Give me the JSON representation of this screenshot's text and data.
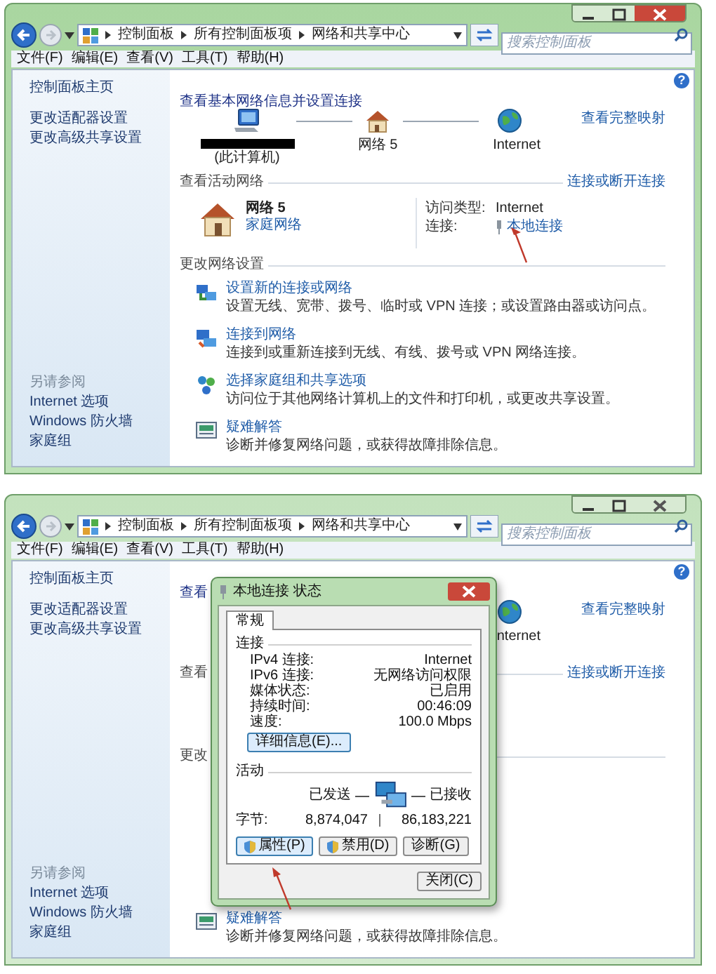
{
  "windows": [
    {
      "active": true,
      "breadcrumb": [
        "控制面板",
        "所有控制面板项",
        "网络和共享中心"
      ],
      "search": {
        "placeholder": "搜索控制面板"
      },
      "menu": [
        "文件(F)",
        "编辑(E)",
        "查看(V)",
        "工具(T)",
        "帮助(H)"
      ],
      "sidebar": {
        "links": [
          "控制面板主页",
          "更改适配器设置",
          "更改高级共享设置"
        ],
        "see_also_title": "另请参阅",
        "see_also": [
          "Internet 选项",
          "Windows 防火墙",
          "家庭组"
        ]
      },
      "main": {
        "help_icon": "?",
        "title": "查看基本网络信息并设置连接",
        "map": [
          {
            "kind": "computer",
            "label": "(此计算机)",
            "redacted": true
          },
          {
            "kind": "house",
            "label": "网络 5",
            "redacted": false
          },
          {
            "kind": "globe",
            "label": "Internet",
            "redacted": false
          }
        ],
        "map_link": "查看完整映射",
        "active_section": {
          "title": "查看活动网络",
          "link": "连接或断开连接"
        },
        "network": {
          "name": "网络 5",
          "type": "家庭网络",
          "access_label": "访问类型:",
          "access_value": "Internet",
          "connection_label": "连接:",
          "connection_value": "本地连接"
        },
        "change_section": "更改网络设置",
        "tasks": [
          {
            "kind": "setup",
            "link": "设置新的连接或网络",
            "description": "设置无线、宽带、拨号、临时或 VPN 连接；或设置路由器或访问点。"
          },
          {
            "kind": "connect",
            "link": "连接到网络",
            "description": "连接到或重新连接到无线、有线、拨号或 VPN 网络连接。"
          },
          {
            "kind": "homegroup",
            "link": "选择家庭组和共享选项",
            "description": "访问位于其他网络计算机上的文件和打印机，或更改共享设置。"
          },
          {
            "kind": "troubleshoot",
            "link": "疑难解答",
            "description": "诊断并修复网络问题，或获得故障排除信息。"
          }
        ]
      },
      "annotation_arrow": true
    },
    {
      "active": false,
      "breadcrumb": [
        "控制面板",
        "所有控制面板项",
        "网络和共享中心"
      ],
      "search": {
        "placeholder": "搜索控制面板"
      },
      "menu": [
        "文件(F)",
        "编辑(E)",
        "查看(V)",
        "工具(T)",
        "帮助(H)"
      ],
      "sidebar": {
        "links": [
          "控制面板主页",
          "更改适配器设置",
          "更改高级共享设置"
        ],
        "see_also_title": "另请参阅",
        "see_also": [
          "Internet 选项",
          "Windows 防火墙",
          "家庭组"
        ]
      },
      "main": {
        "help_icon": "?",
        "title": "查看",
        "map": [
          {
            "kind": "globe",
            "label": "nternet",
            "redacted": false
          }
        ],
        "map_link": "查看完整映射",
        "active_section": {
          "title": "查看",
          "link": "连接或断开连接"
        },
        "change_section": "更改",
        "tasks": [
          {
            "kind": "troubleshoot",
            "link": "疑难解答",
            "description": "诊断并修复网络问题，或获得故障排除信息。"
          }
        ]
      },
      "annotation_arrow": true,
      "dialog": {
        "title": "本地连接 状态",
        "tabs": [
          {
            "label": "常规",
            "selected": true
          }
        ],
        "connection": {
          "title": "连接",
          "rows": [
            {
              "label": "IPv4 连接:",
              "value": "Internet"
            },
            {
              "label": "IPv6 连接:",
              "value": "无网络访问权限"
            },
            {
              "label": "媒体状态:",
              "value": "已启用"
            },
            {
              "label": "持续时间:",
              "value": "00:46:09"
            },
            {
              "label": "速度:",
              "value": "100.0 Mbps"
            }
          ]
        },
        "details_button": {
          "label": "详细信息(E)...",
          "highlighted": true
        },
        "activity": {
          "title": "活动",
          "sent_label": "已发送",
          "received_label": "已接收",
          "bytes_label": "字节:",
          "sent": "8,874,047",
          "received": "86,183,221"
        },
        "buttons": [
          {
            "label": "属性(P)",
            "shield": true,
            "highlighted": true
          },
          {
            "label": "禁用(D)",
            "shield": true,
            "highlighted": false
          },
          {
            "label": "诊断(G)",
            "shield": false,
            "highlighted": false
          }
        ],
        "close_button": "关闭(C)"
      }
    }
  ]
}
